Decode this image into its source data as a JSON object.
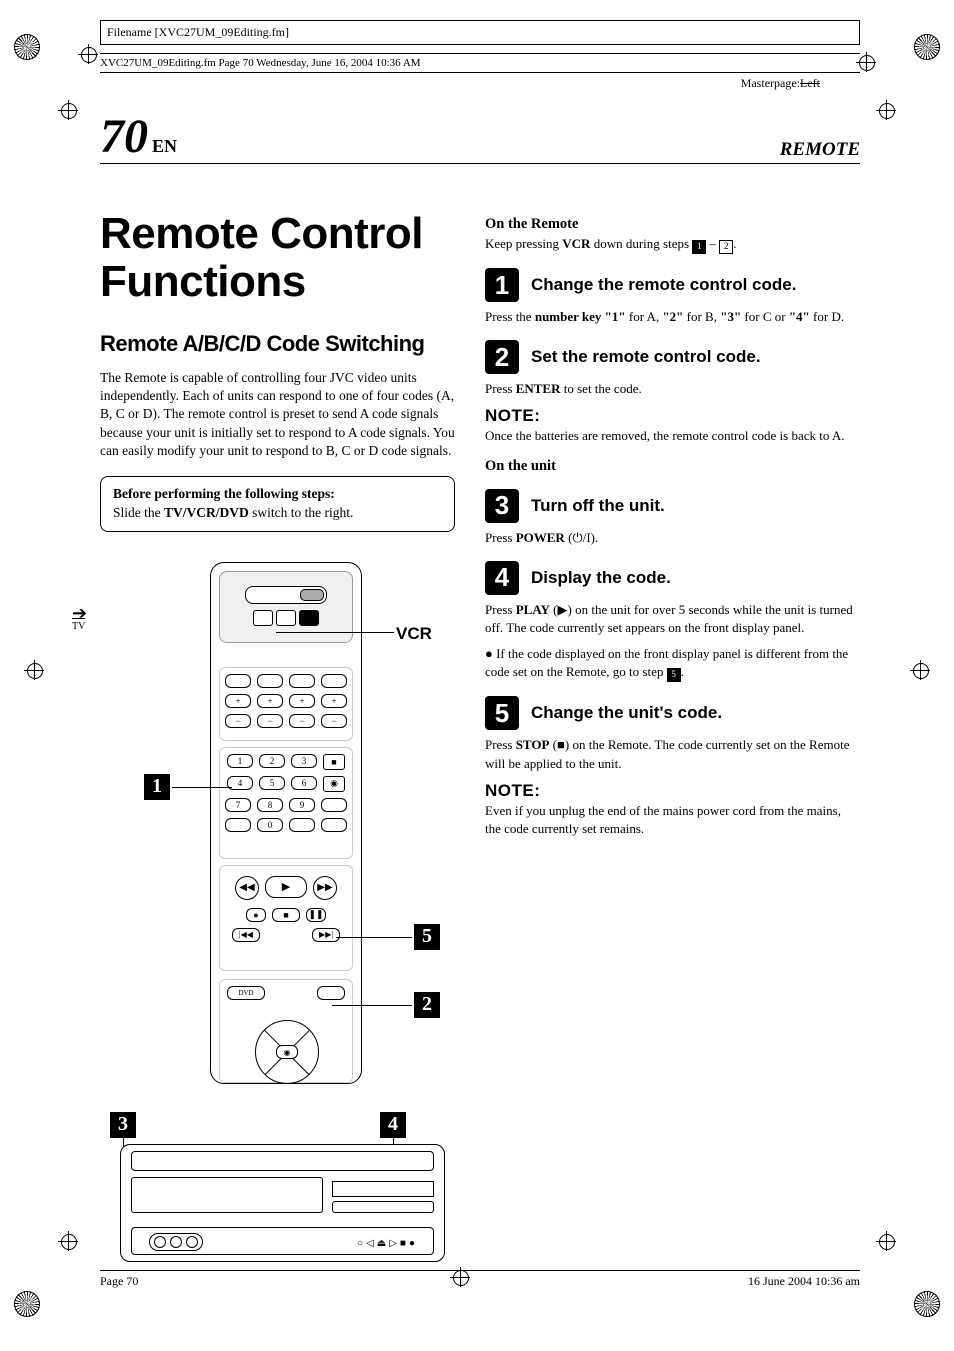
{
  "filename_label": "Filename [XVC27UM_09Editing.fm]",
  "header_line": "XVC27UM_09Editing.fm  Page 70  Wednesday, June 16, 2004  10:36 AM",
  "masterpage_prefix": "Masterpage:",
  "masterpage_value": "Left",
  "page_number": "70",
  "page_lang": "EN",
  "section_label": "REMOTE",
  "title": "Remote Control Functions",
  "subtitle": "Remote A/B/C/D Code Switching",
  "intro_paragraph": "The Remote is capable of controlling four JVC video units independently. Each of units can respond to one of four codes (A, B, C or D). The remote control is preset to send A code signals because your unit is initially set to respond to A code signals. You can easily modify your unit to respond to B, C or D code signals.",
  "box_line1": "Before performing the following steps:",
  "box_line2_pre": "Slide the ",
  "box_line2_strong": "TV/VCR/DVD",
  "box_line2_post": " switch to the right.",
  "remote_tv_label": "TV",
  "remote_vcr_label": "VCR",
  "callouts": {
    "c1": "1",
    "c2": "2",
    "c3": "3",
    "c4": "4",
    "c5": "5"
  },
  "remote_section": {
    "heading": "On the Remote",
    "intro_pre": "Keep pressing ",
    "intro_strong": "VCR",
    "intro_mid": " down during steps ",
    "intro_a": "1",
    "intro_dash": " – ",
    "intro_b": "2",
    "intro_post": "."
  },
  "step": {
    "s1": {
      "num": "1",
      "title": "Change the remote control code.",
      "text_pre": "Press the ",
      "text_b1": "number key \"1\"",
      "text_mid1": " for A, ",
      "text_b2": "\"2\"",
      "text_mid2": " for B, ",
      "text_b3": "\"3\"",
      "text_mid3": " for C or ",
      "text_b4": "\"4\"",
      "text_post": " for D."
    },
    "s2": {
      "num": "2",
      "title": "Set the remote control code.",
      "text_pre": "Press ",
      "text_b1": "ENTER",
      "text_post": " to set the code."
    },
    "note1_head": "NOTE:",
    "note1_body": "Once the batteries are removed, the remote control code is back to A.",
    "unit_heading": "On the unit",
    "s3": {
      "num": "3",
      "title": "Turn off the unit.",
      "text_pre": "Press ",
      "text_b1": "POWER",
      "text_post_icon_pre": " (",
      "text_post_icon_post": ")."
    },
    "s4": {
      "num": "4",
      "title": "Display the code.",
      "text_pre": "Press ",
      "text_b1": "PLAY",
      "text_icon_pre": " (",
      "text_icon_post": ") on the unit for over 5 seconds while the unit is turned off. The code currently set appears on the front display panel.",
      "bullet_pre": "● If the code displayed on the front display panel is different from the code set on the Remote, go to step ",
      "bullet_box": "5",
      "bullet_post": "."
    },
    "s5": {
      "num": "5",
      "title": "Change the unit's code.",
      "text_pre": "Press ",
      "text_b1": "STOP",
      "text_icon_pre": " (",
      "text_icon_post": ") on the Remote. The code currently set on the Remote will be applied to the unit."
    },
    "note2_head": "NOTE:",
    "note2_body": "Even if you unplug the end of the mains power cord from the mains, the code currently set remains."
  },
  "footer_left": "Page 70",
  "footer_right": "16 June 2004 10:36 am"
}
